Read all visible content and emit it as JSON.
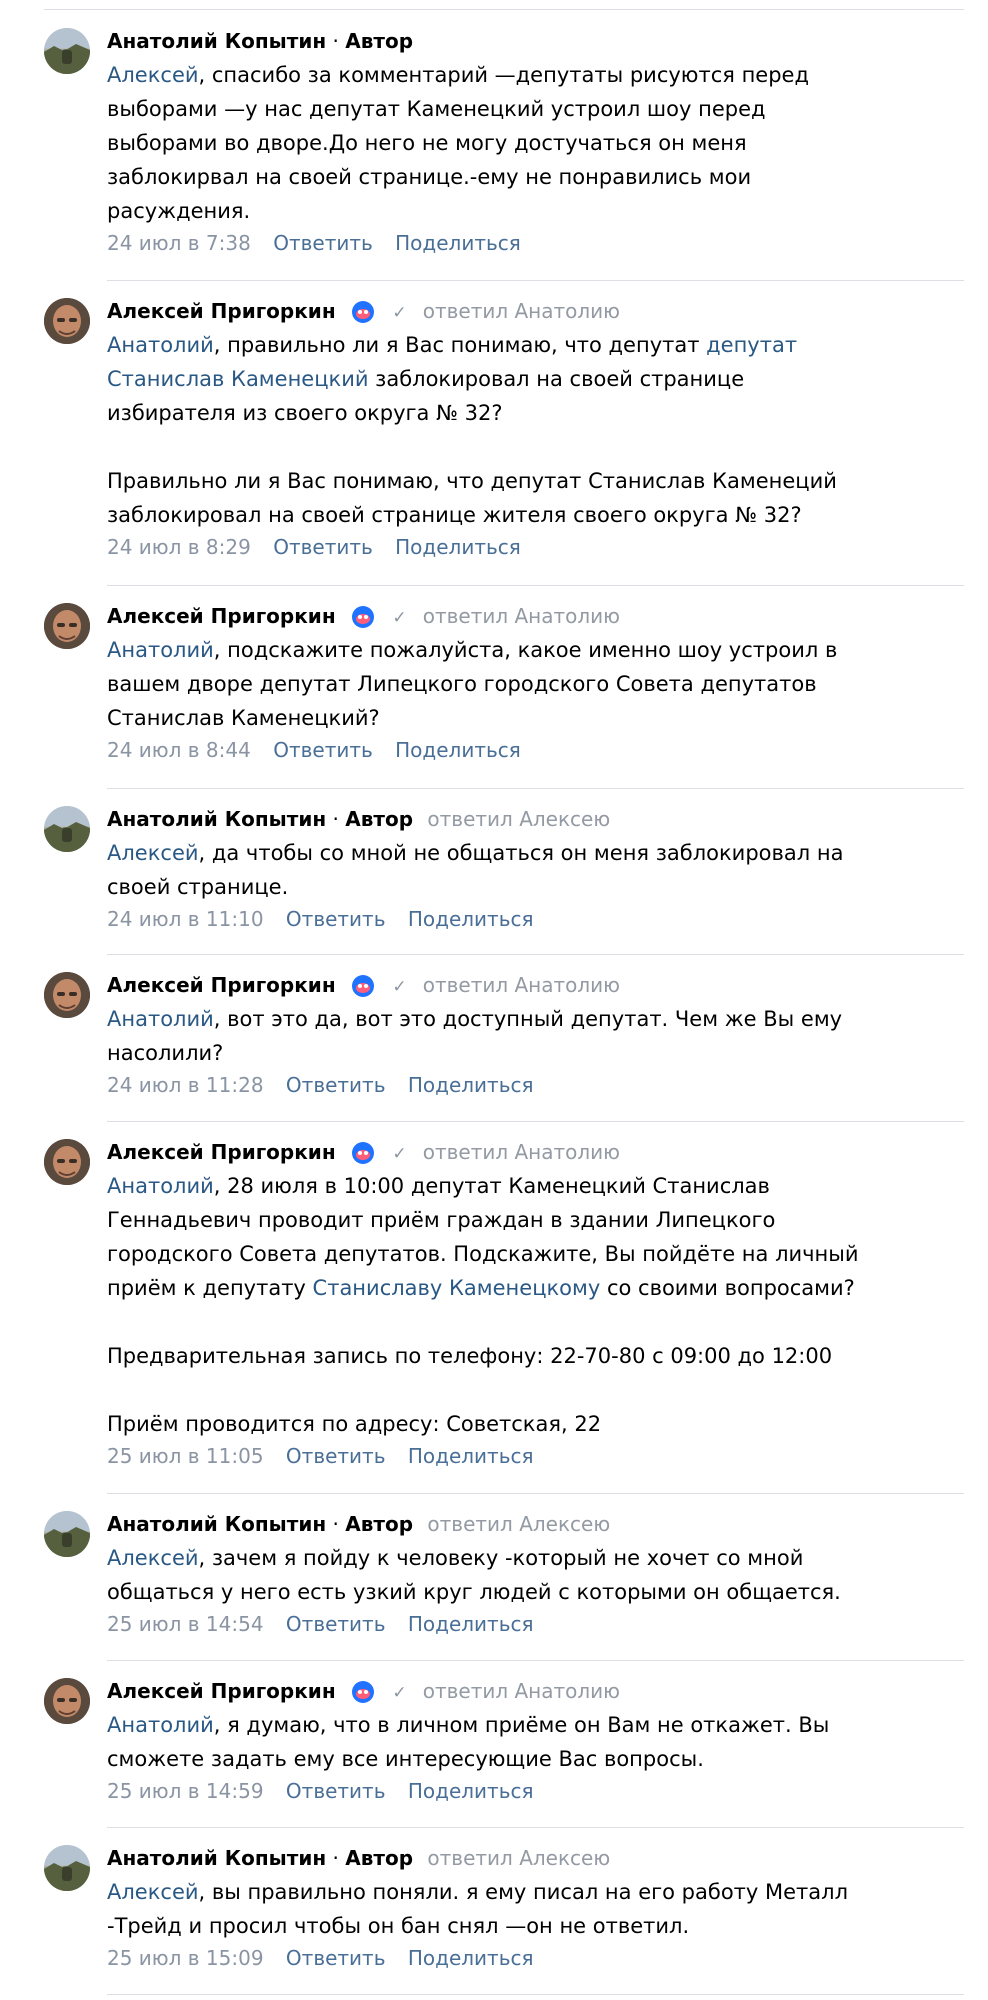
{
  "labels": {
    "author_badge": "Автор",
    "separator": "·",
    "reply_action": "Ответить",
    "share_action": "Поделиться"
  },
  "icons": {
    "verified_badge": "blue-crowned-badge-icon",
    "check": "check-icon",
    "avatar_anatoly": "landscape-avatar",
    "avatar_aleksey": "man-avatar"
  },
  "colors": {
    "mention": "#2a5885",
    "action": "#4a6f97",
    "meta": "#8a94a3",
    "divider": "#dcdfe3",
    "reply_hint": "#939aa3"
  },
  "comments": [
    {
      "author": "Анатолий Копытин",
      "is_author": true,
      "reply_to": "",
      "text_mention": "Алексей",
      "text_lines": [
        ", спасибо за комментарий —депутаты рисуются перед",
        "выборами —у нас депутат Каменецкий устроил шоу перед",
        "выборами во дворе.До него не могу достучаться он меня",
        "заблокирвал на своей странице.-ему не понравились мои",
        "расуждения."
      ],
      "date": "24 июл в 7:38"
    },
    {
      "author": "Алексей Пригоркин",
      "is_author": false,
      "reply_to": "ответил Анатолию",
      "text_mention": "Анатолий",
      "line1_a": ", правильно ли я Вас понимаю, что депутат ",
      "line1_link": "депутат",
      "line2_link": "Станислав Каменецкий",
      "line2_b": " заблокировал на своей странице",
      "line3": "избирателя из своего округа № 32?",
      "line5": "Правильно ли я Вас понимаю, что депутат Станислав Каменеций",
      "line6": "заблокировал на своей странице жителя своего округа № 32?",
      "date": "24 июл в 8:29"
    },
    {
      "author": "Алексей Пригоркин",
      "is_author": false,
      "reply_to": "ответил Анатолию",
      "text_mention": "Анатолий",
      "text_lines": [
        ", подскажите пожалуйста, какое именно шоу устроил в",
        "вашем дворе депутат Липецкого городского Совета депутатов",
        "Станислав Каменецкий?"
      ],
      "date": "24 июл в 8:44"
    },
    {
      "author": "Анатолий Копытин",
      "is_author": true,
      "reply_to": "ответил Алексею",
      "text_mention": "Алексей",
      "text_lines": [
        ", да чтобы со мной не общаться он меня заблокировал на",
        "своей странице."
      ],
      "date": "24 июл в 11:10"
    },
    {
      "author": "Алексей Пригоркин",
      "is_author": false,
      "reply_to": "ответил Анатолию",
      "text_mention": "Анатолий",
      "text_lines": [
        ", вот это да, вот это доступный депутат. Чем же Вы ему",
        "насолили?"
      ],
      "date": "24 июл в 11:28"
    },
    {
      "author": "Алексей Пригоркин",
      "is_author": false,
      "reply_to": "ответил Анатолию",
      "text_mention": "Анатолий",
      "line1": ", 28 июля в 10:00 депутат Каменецкий Станислав",
      "line2": "Геннадьевич проводит приём граждан в здании Липецкого",
      "line3": "городского Совета депутатов. Подскажите, Вы пойдёте на личный",
      "line4_a": "приём к депутату ",
      "line4_link": "Станиславу Каменецкому",
      "line4_b": " со своими вопросами?",
      "line6": "Предварительная запись по телефону: 22-70-80 с 09:00 до 12:00",
      "line8": "Приём проводится по адресу: Советская, 22",
      "date": "25 июл в 11:05"
    },
    {
      "author": "Анатолий Копытин",
      "is_author": true,
      "reply_to": "ответил Алексею",
      "text_mention": "Алексей",
      "text_lines": [
        ", зачем я пойду к человеку -который не хочет со мной",
        "общаться у него есть узкий круг людей с которыми он общается."
      ],
      "date": "25 июл в 14:54"
    },
    {
      "author": "Алексей Пригоркин",
      "is_author": false,
      "reply_to": "ответил Анатолию",
      "text_mention": "Анатолий",
      "text_lines": [
        ", я думаю, что в личном приёме он Вам не откажет. Вы",
        "сможете задать ему все интересующие Вас вопросы."
      ],
      "date": "25 июл в 14:59"
    },
    {
      "author": "Анатолий Копытин",
      "is_author": true,
      "reply_to": "ответил Алексею",
      "text_mention": "Алексей",
      "text_lines": [
        ", вы правильно поняли. я ему писал на его работу Металл",
        "-Трейд и просил чтобы он бан снял —он не ответил."
      ],
      "date": "25 июл в 15:09"
    }
  ]
}
